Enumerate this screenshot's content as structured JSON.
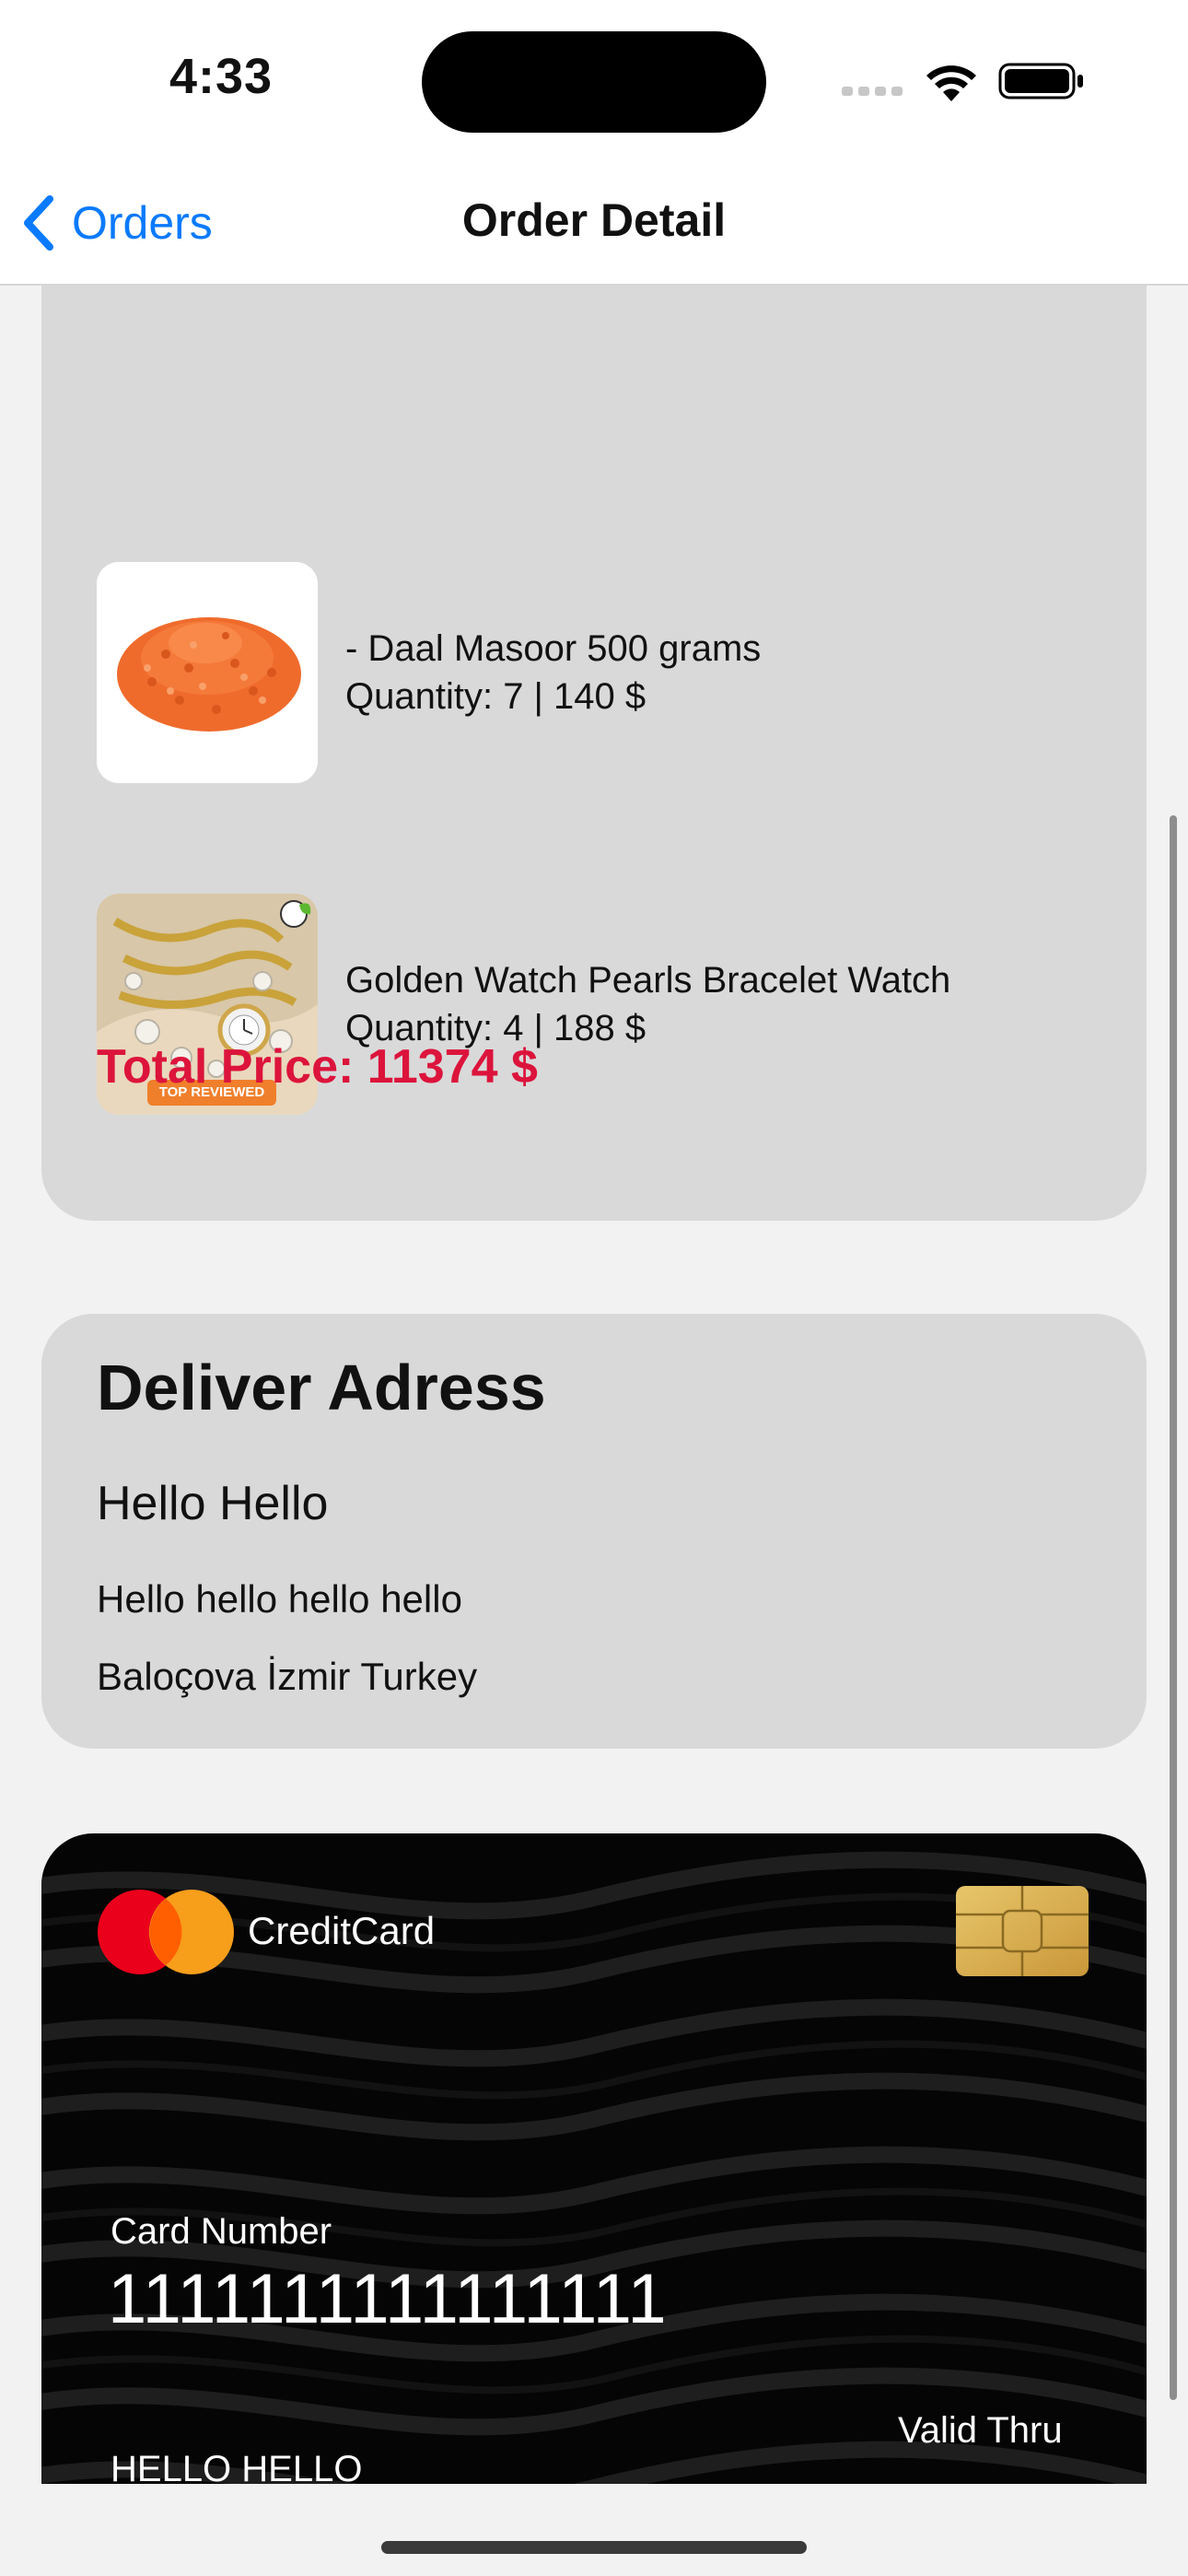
{
  "status_bar": {
    "time": "4:33"
  },
  "nav": {
    "back_label": "Orders",
    "title": "Order Detail"
  },
  "order": {
    "items": [
      {
        "name": "- Daal Masoor 500 grams",
        "detail": "Quantity: 7 | 140 $"
      },
      {
        "name": "Golden Watch Pearls Bracelet Watch",
        "detail": "Quantity: 4 | 188 $",
        "badge": "TOP REVIEWED"
      }
    ],
    "total": "Total Price: 11374 $"
  },
  "address": {
    "title": "Deliver Adress",
    "name": "Hello Hello",
    "line1": "Hello hello hello hello",
    "line2": "Baloçova İzmir Turkey"
  },
  "credit_card": {
    "brand": "CreditCard",
    "number_label": "Card Number",
    "number": "1111111111111111",
    "valid_label": "Valid Thru",
    "holder": "HELLO HELLO"
  },
  "colors": {
    "accent": "#0a7aff",
    "total": "#dc143c",
    "card_bg": "#d9d9d9"
  }
}
